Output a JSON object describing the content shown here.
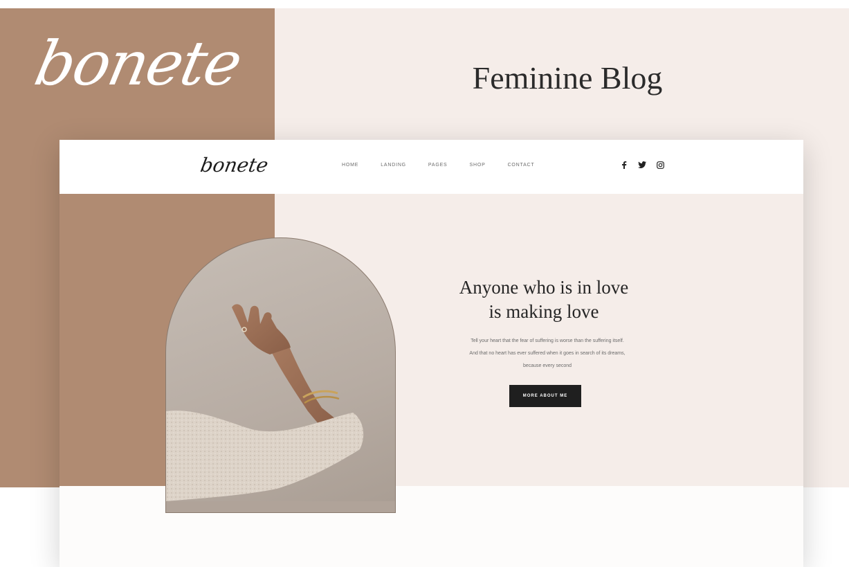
{
  "promo": {
    "logo": "bonete",
    "title": "Feminine Blog"
  },
  "mockup": {
    "header": {
      "logo": "bonete",
      "nav": [
        "HOME",
        "LANDING",
        "PAGES",
        "SHOP",
        "CONTACT"
      ],
      "social_icons": [
        "facebook-icon",
        "twitter-icon",
        "instagram-icon"
      ]
    },
    "hero": {
      "heading_line1": "Anyone who is in love",
      "heading_line2": "is making love",
      "text_line1": "Tell your heart that the fear of suffering is worse than the suffering itself.",
      "text_line2": "And that no heart has ever suffered when it goes in search of its dreams,",
      "text_line3": "because every second",
      "button_label": "MORE ABOUT ME"
    }
  },
  "colors": {
    "brown": "#b08b72",
    "blush": "#f5ede9",
    "dark": "#1f1f1f"
  }
}
